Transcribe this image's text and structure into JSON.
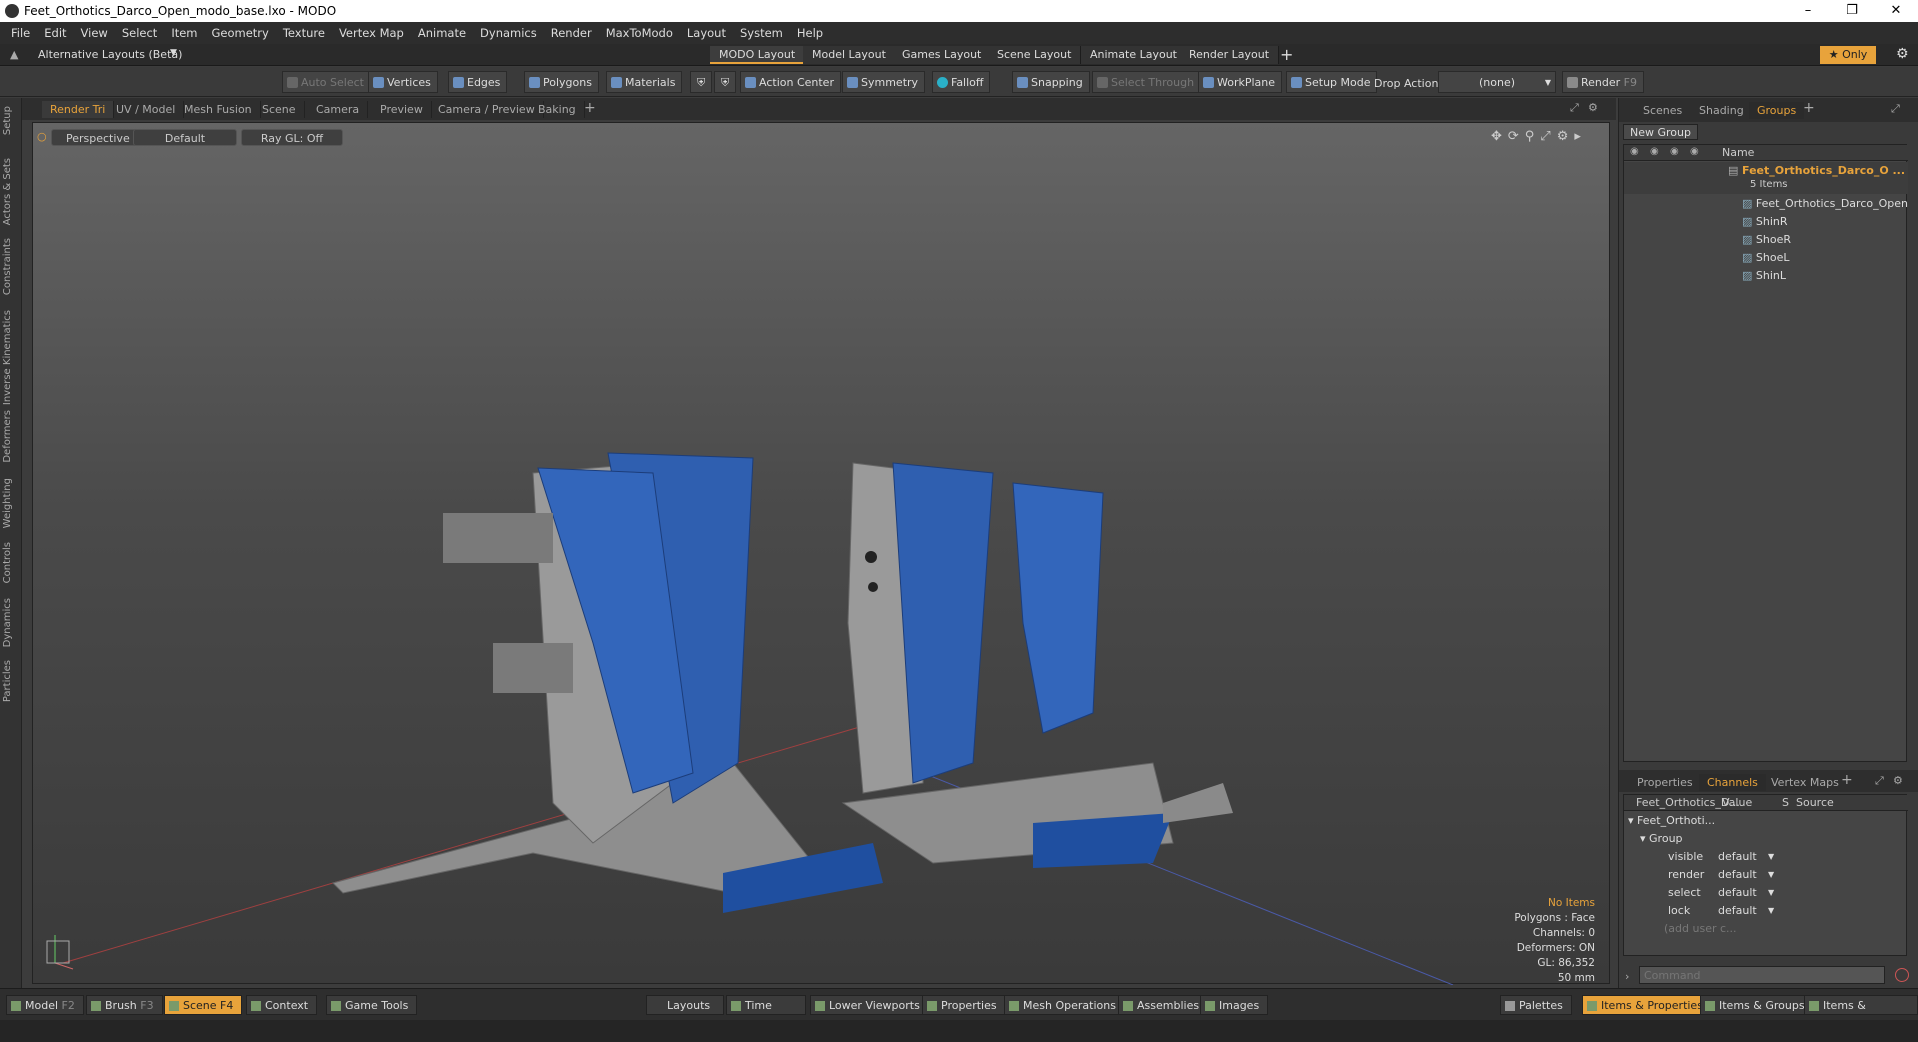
{
  "window": {
    "title": "Feet_Orthotics_Darco_Open_modo_base.lxo - MODO"
  },
  "menu": [
    "File",
    "Edit",
    "View",
    "Select",
    "Item",
    "Geometry",
    "Texture",
    "Vertex Map",
    "Animate",
    "Dynamics",
    "Render",
    "MaxToModo",
    "Layout",
    "System",
    "Help"
  ],
  "layouts": {
    "dropdown": "Alternative Layouts (Beta)",
    "tabs": [
      "MODO Layout",
      "Model Layout",
      "Games Layout",
      "Scene Layout",
      "Animate Layout",
      "Render Layout"
    ],
    "only": "Only"
  },
  "toolbar": {
    "auto_select": "Auto Select",
    "vertices": "Vertices",
    "edges": "Edges",
    "polygons": "Polygons",
    "materials": "Materials",
    "action_center": "Action Center",
    "symmetry": "Symmetry",
    "falloff": "Falloff",
    "snapping": "Snapping",
    "select_through": "Select Through",
    "workplane": "WorkPlane",
    "setup_mode": "Setup Mode",
    "drop_action": "Drop Action",
    "drop_value": "(none)",
    "render": "Render",
    "render_key": "F9"
  },
  "left_tabs": [
    "Setup",
    "Actors & Sets",
    "Constraints",
    "Inverse Kinematics",
    "Deformers",
    "Weighting",
    "Controls",
    "Dynamics",
    "Particles"
  ],
  "viewport": {
    "tabs": [
      "Render Tri",
      "UV / Model",
      "Mesh Fusion",
      "Scene",
      "Camera",
      "Preview",
      "Camera / Preview",
      "Baking"
    ],
    "perspective": "Perspective",
    "shading": "Default",
    "raygl": "Ray GL: Off",
    "stats": {
      "items": "No Items",
      "polygons": "Polygons : Face",
      "channels": "Channels: 0",
      "deformers": "Deformers: ON",
      "gl": "GL: 86,352",
      "scale": "50 mm"
    }
  },
  "groups_panel": {
    "tabs": [
      "Scenes",
      "Shading",
      "Groups"
    ],
    "new_group": "New Group",
    "name_header": "Name",
    "group_name": "Feet_Orthotics_Darco_O ...",
    "count": "5 Items",
    "items": [
      "Feet_Orthotics_Darco_Open",
      "ShinR",
      "ShoeR",
      "ShoeL",
      "ShinL"
    ]
  },
  "channels_panel": {
    "tabs": [
      "Properties",
      "Channels",
      "Vertex Maps"
    ],
    "col_name": "Feet_Orthotics_D...",
    "col_value": "Value",
    "col_s": "S",
    "col_source": "Source",
    "root": "Feet_Orthoti...",
    "group": "Group",
    "rows": [
      {
        "name": "visible",
        "value": "default"
      },
      {
        "name": "render",
        "value": "default"
      },
      {
        "name": "select",
        "value": "default"
      },
      {
        "name": "lock",
        "value": "default"
      }
    ],
    "add_user": "(add user c...",
    "command_placeholder": "Command"
  },
  "statusbar": {
    "model": "Model",
    "model_key": "F2",
    "brush": "Brush",
    "brush_key": "F3",
    "scene": "Scene",
    "scene_key": "F4",
    "context": "Context",
    "game_tools": "Game Tools",
    "layouts": "Layouts",
    "time": "Time",
    "lower_viewports": "Lower Viewports",
    "properties": "Properties",
    "mesh_operations": "Mesh Operations",
    "assemblies": "Assemblies",
    "images": "Images",
    "palettes": "Palettes",
    "items_properties": "Items & Properties",
    "items_groups": "Items & Groups",
    "items_shading": "Items & Shading"
  }
}
